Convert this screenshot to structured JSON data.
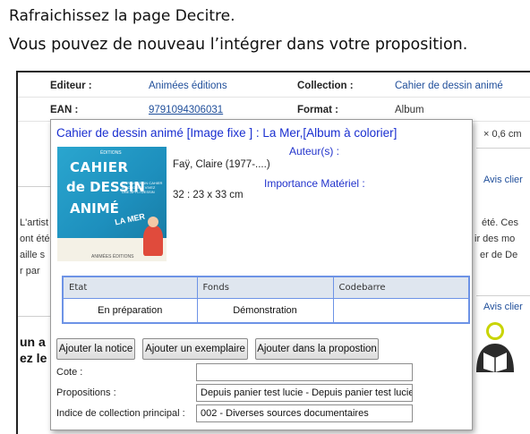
{
  "instructions": {
    "line1": "Rafraichissez la page Decitre.",
    "line2": "Vous pouvez de nouveau l’intégrer dans votre proposition."
  },
  "background": {
    "editeur_label": "Editeur :",
    "editeur_value": "Animées éditions",
    "collection_label": "Collection :",
    "collection_value": "Cahier de dessin animé",
    "ean_label": "EAN :",
    "ean_value": "9791094306031",
    "format_label": "Format :",
    "format_value": "Album",
    "dimension_fragment": "× 0,6 cm",
    "avis_1": "Avis clier",
    "avis_2": "Avis clier",
    "left_frag_1": "L'artist",
    "left_frag_2": "ont été",
    "left_frag_3": "aille s",
    "left_frag_4": "r par",
    "right_frag_1": "été. Ces",
    "right_frag_2": "ir des mo",
    "right_frag_3": "er de De",
    "bold_frag_1": "un a",
    "bold_frag_2": "ez le"
  },
  "modal": {
    "title": "Cahier de dessin animé [Image fixe ] : La Mer,[Album à colorier]",
    "auteurs_label": "Auteur(s) :",
    "author": "Faÿ, Claire (1977-....)",
    "importance_label": "Importance Matériel :",
    "importance_value": "32 : 23 x 33 cm",
    "cover": {
      "publisher": "ÉDITIONS",
      "line1": "CAHIER",
      "line2": "de DESSIN",
      "line3": "ANIMÉ",
      "line4": "LA MER",
      "blurb": "À TRAVERS UN CAHIER À COLORIER VIVEZ UNE APPLI DESSIN",
      "editor": "ANIMÉES ÉDITIONS"
    },
    "table": {
      "headers": [
        "Etat",
        "Fonds",
        "Codebarre"
      ],
      "row": [
        "En préparation",
        "Démonstration",
        ""
      ]
    },
    "buttons": {
      "add_notice": "Ajouter la notice",
      "add_copy": "Ajouter un exemplaire",
      "add_proposal": "Ajouter dans la propostion"
    },
    "fields": {
      "cote_label": "Cote :",
      "cote_value": "",
      "propositions_label": "Propositions :",
      "propositions_value": "Depuis panier test lucie - Depuis panier test lucie",
      "indice_label": "Indice de collection principal :",
      "indice_value": "002 - Diverses sources documentaires"
    }
  }
}
